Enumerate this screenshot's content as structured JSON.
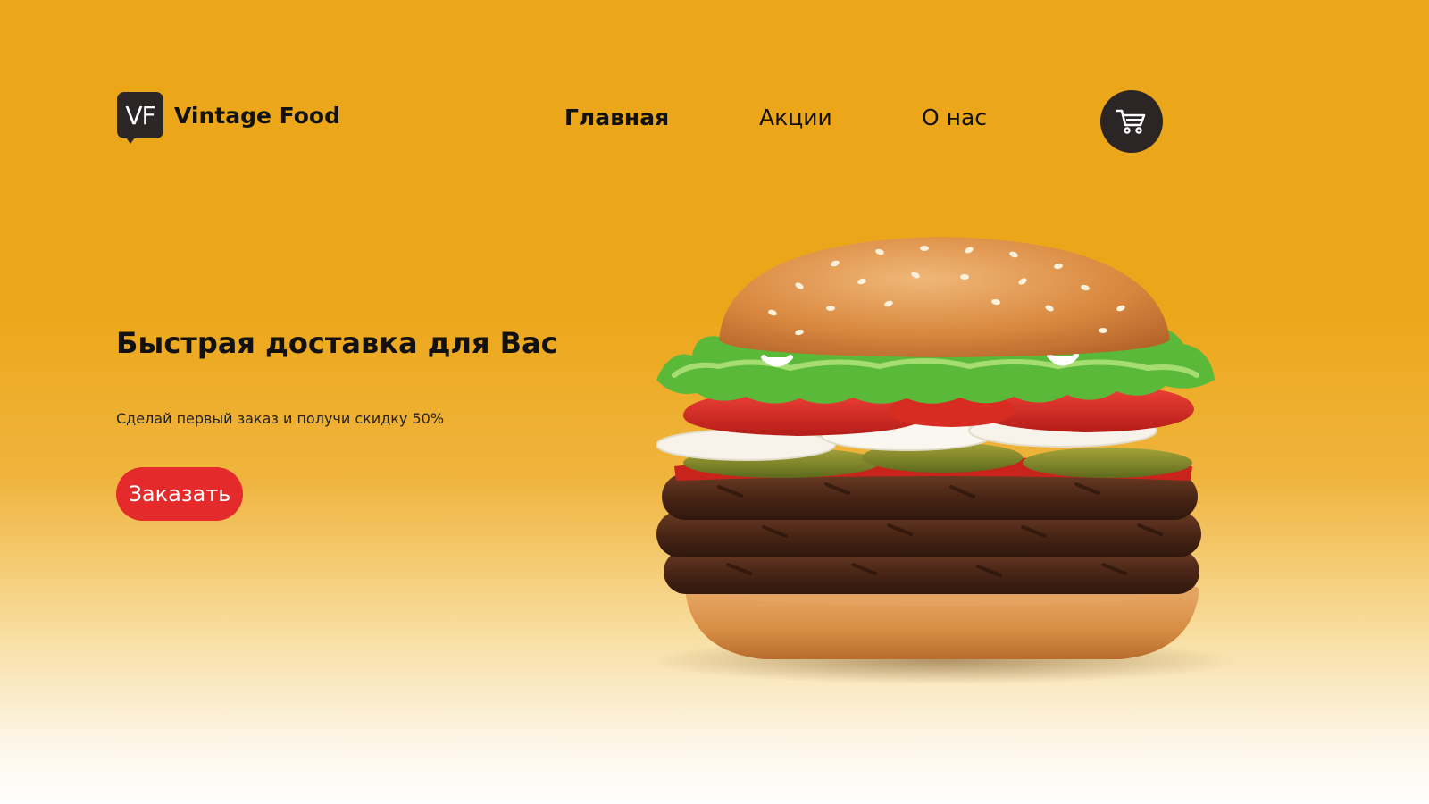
{
  "header": {
    "logo_mark": "VF",
    "brand_name": "Vintage Food",
    "nav": [
      {
        "label": "Главная",
        "active": true
      },
      {
        "label": "Акции",
        "active": false
      },
      {
        "label": "О нас",
        "active": false
      }
    ],
    "cart_icon": "shopping-cart-icon"
  },
  "hero": {
    "title": "Быстрая доставка для Вас",
    "subtitle": "Сделай первый заказ и получи скидку 50%",
    "cta_label": "Заказать",
    "image": "burger-image"
  },
  "colors": {
    "background": "#eca619",
    "dark": "#2b2526",
    "accent_red": "#e42a2a",
    "text": "#111111"
  }
}
